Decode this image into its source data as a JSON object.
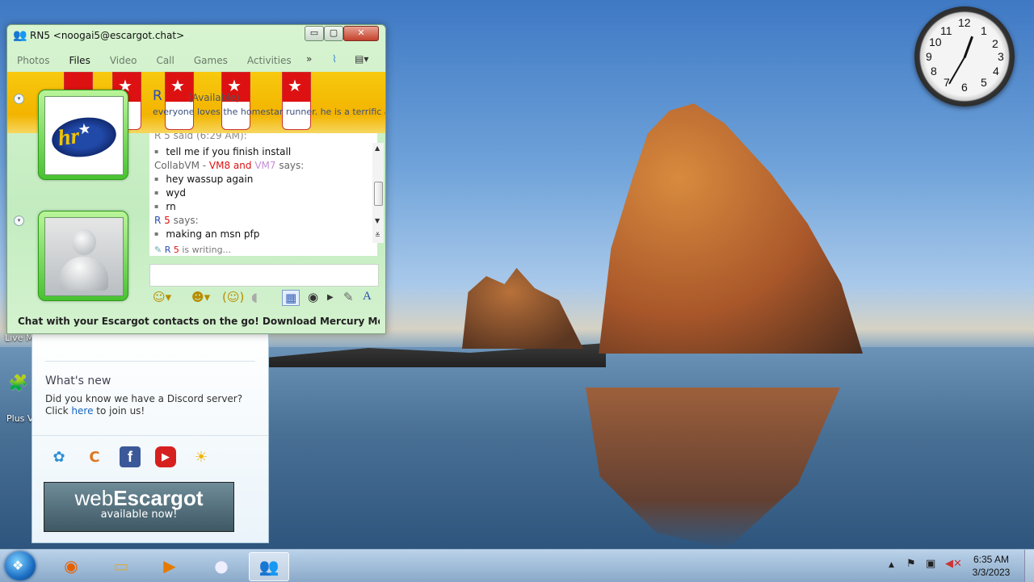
{
  "window": {
    "title": "RN5 <noogai5@escargot.chat>",
    "min": "▭",
    "max": "▢",
    "close": "✕"
  },
  "menu": [
    "Photos",
    "Files",
    "Video",
    "Call",
    "Games",
    "Activities"
  ],
  "menu_active": "Files",
  "menu_more": "»",
  "contact": {
    "name_r": "R",
    "name_5": "5",
    "status": "(Available)",
    "psm": "everyone loves the homestar runner. he is a terrific a..."
  },
  "history": {
    "partial": "R  5 said (6:29 AM):",
    "msg1": "tell me if you finish install",
    "sender2_a": "CollabVM",
    "sender2_sep": " - ",
    "sender2_b": "VM8 and",
    "sender2_c": "VM7",
    "sender2_d": " says:",
    "msg2": "hey wassup again",
    "msg3": "wyd",
    "msg4": "rn",
    "sender3_r": "R",
    "sender3_5": "5",
    "sender3_says": "says:",
    "msg5": "making an msn pfp"
  },
  "typing": {
    "r": "R",
    "five": "5",
    "text": "is writing..."
  },
  "promo": "Chat with your Escargot contacts on the go! Download Mercury Messenger (A...",
  "contactlist": {
    "whatsnew": "What's new",
    "text_before": "Did you know we have a Discord server? Click ",
    "link": "here",
    "text_after": " to join us!",
    "banner_web": "web",
    "banner_esc": "Escargot",
    "banner_sub": "available now!"
  },
  "desktop_labels": {
    "live": "Live M",
    "plus": "Plus V"
  },
  "clock_gadget": {
    "n12": "12",
    "n1": "1",
    "n2": "2",
    "n3": "3",
    "n4": "4",
    "n5": "5",
    "n6": "6",
    "n7": "7",
    "n8": "8",
    "n9": "9",
    "n10": "10",
    "n11": "11"
  },
  "taskbar": {
    "time": "6:35 AM",
    "date": "3/3/2023"
  },
  "colors": {
    "accent": "#2a4db3",
    "red_name": "#d11",
    "vm7": "#c58cd6"
  }
}
